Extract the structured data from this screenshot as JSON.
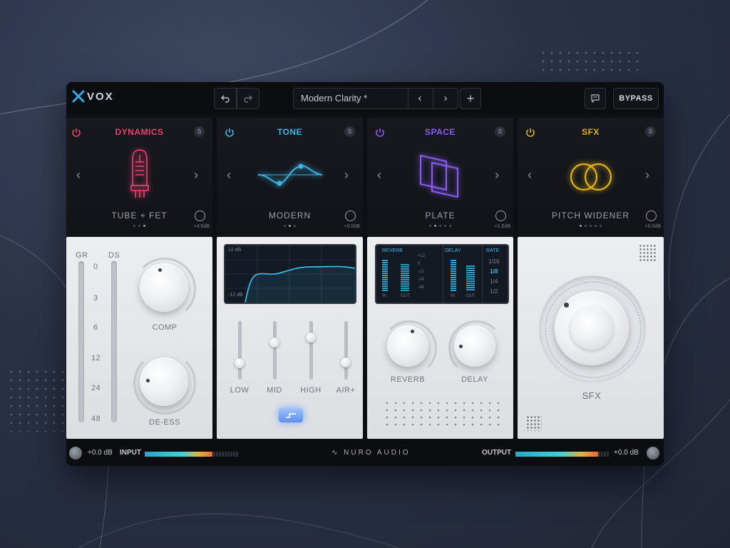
{
  "app": {
    "title": "VOX"
  },
  "toolbar": {
    "undo_icon": "undo-icon",
    "redo_icon": "redo-icon",
    "preset_name": "Modern Clarity *",
    "prev_icon": "chevron-left-icon",
    "next_icon": "chevron-right-icon",
    "add_icon": "plus-icon",
    "comment_icon": "chat-icon",
    "bypass_label": "BYPASS"
  },
  "modules": [
    {
      "title": "DYNAMICS",
      "color": "#e8436f",
      "mode": "TUBE + FET",
      "value": "+4.0dB",
      "icon": "vacuum-tube-icon"
    },
    {
      "title": "TONE",
      "color": "#39b6e6",
      "mode": "MODERN",
      "value": "+0.0dB",
      "icon": "eq-curve-icon"
    },
    {
      "title": "SPACE",
      "color": "#8b5cf6",
      "mode": "PLATE",
      "value": "+1.5dB",
      "icon": "plate-icon"
    },
    {
      "title": "SFX",
      "color": "#e2b21c",
      "mode": "PITCH WIDENER",
      "value": "+0.0dB",
      "icon": "rings-icon"
    }
  ],
  "dynamics": {
    "gr_label": "GR",
    "ds_label": "DS",
    "scale": [
      "0",
      "3",
      "6",
      "12",
      "24",
      "48"
    ],
    "comp_label": "COMP",
    "deess_label": "DE-ESS"
  },
  "tone": {
    "eq_top": "12 dB",
    "eq_bottom": "-12 dB",
    "bands": [
      "LOW",
      "MID",
      "HIGH",
      "AIR+"
    ]
  },
  "space": {
    "reverb_screen": "REVERB",
    "delay_screen": "DELAY",
    "rate_label": "RATE",
    "rates": [
      "1/16",
      "1/8",
      "1/4",
      "1/2"
    ],
    "active_rate": "1/8",
    "scale": [
      "+12",
      "0",
      "-12",
      "-24",
      "-48"
    ],
    "in_label": "IN",
    "out_label": "OUT",
    "reverb_label": "REVERB",
    "delay_label": "DELAY"
  },
  "sfx": {
    "label": "SFX"
  },
  "footer": {
    "input_db": "+0.0 dB",
    "input_label": "INPUT",
    "brand": "NURO AUDIO",
    "output_label": "OUTPUT",
    "output_db": "+0.0 dB",
    "input_level": 0.72,
    "output_level": 0.88
  }
}
